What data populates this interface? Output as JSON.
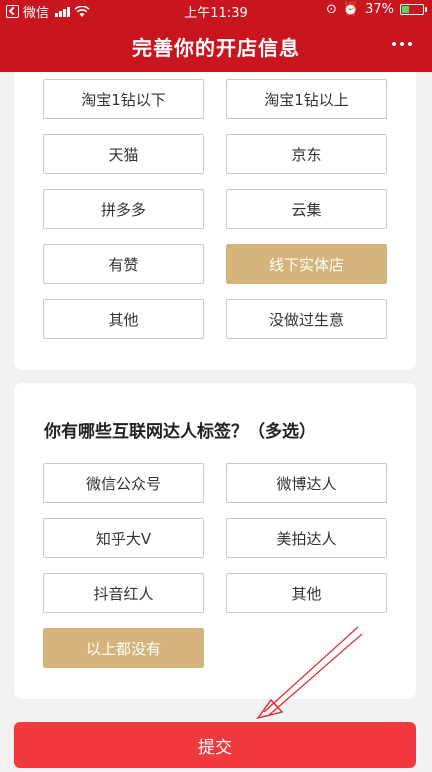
{
  "status_bar": {
    "carrier": "微信",
    "time": "上午11:39",
    "battery": "37%",
    "battery_level": 0.37
  },
  "header": {
    "title": "完善你的开店信息"
  },
  "shop_types": {
    "options": [
      {
        "label": "淘宝1钻以下",
        "selected": false
      },
      {
        "label": "淘宝1钻以上",
        "selected": false
      },
      {
        "label": "天猫",
        "selected": false
      },
      {
        "label": "京东",
        "selected": false
      },
      {
        "label": "拼多多",
        "selected": false
      },
      {
        "label": "云集",
        "selected": false
      },
      {
        "label": "有赞",
        "selected": false
      },
      {
        "label": "线下实体店",
        "selected": true
      },
      {
        "label": "其他",
        "selected": false
      },
      {
        "label": "没做过生意",
        "selected": false
      }
    ]
  },
  "influencer": {
    "question": "你有哪些互联网达人标签？（多选）",
    "options": [
      {
        "label": "微信公众号",
        "selected": false
      },
      {
        "label": "微博达人",
        "selected": false
      },
      {
        "label": "知乎大V",
        "selected": false
      },
      {
        "label": "美拍达人",
        "selected": false
      },
      {
        "label": "抖音红人",
        "selected": false
      },
      {
        "label": "其他",
        "selected": false
      },
      {
        "label": "以上都没有",
        "selected": true
      }
    ]
  },
  "submit": {
    "label": "提交"
  },
  "colors": {
    "brand_red": "#c9151e",
    "selected_gold": "#d4b47a",
    "submit_red": "#f23a3e",
    "annotation_arrow": "#e0282b"
  }
}
